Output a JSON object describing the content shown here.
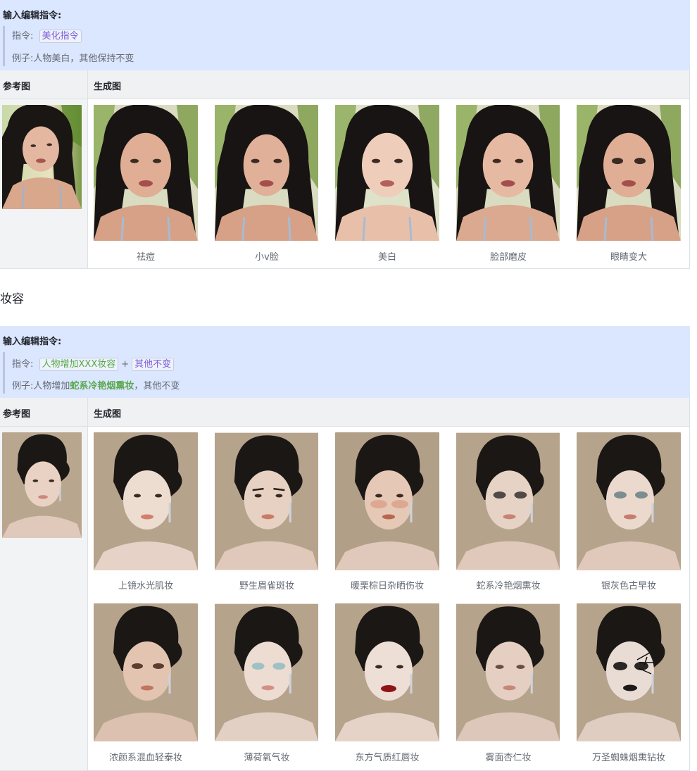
{
  "beauty": {
    "instruction_title": "输入编辑指令:",
    "cmd_label": "指令:",
    "cmd_tag": "美化指令",
    "example_prefix": "例子:",
    "example_text": "人物美白，其他保持不变",
    "ref_header": "参考图",
    "gen_header": "生成图",
    "captions": [
      "祛痘",
      "小v脸",
      "美白",
      "脸部磨皮",
      "眼睛变大"
    ]
  },
  "makeup_section_title": "妆容",
  "makeup": {
    "instruction_title": "输入编辑指令:",
    "cmd_label": "指令:",
    "cmd_tag_1": "人物增加XXX妆容",
    "cmd_plus": "+",
    "cmd_tag_2": "其他不变",
    "example_prefix": "例子:",
    "example_before": "人物增加",
    "example_highlight": "蛇系冷艳烟熏妆",
    "example_after": "，其他不变",
    "ref_header": "参考图",
    "gen_header": "生成图",
    "captions_row1": [
      "上镜水光肌妆",
      "野生眉雀斑妆",
      "暖栗棕日杂晒伤妆",
      "蛇系冷艳烟熏妆",
      "银灰色古早妆"
    ],
    "captions_row2": [
      "浓颜系混血轻泰妆",
      "薄荷氧气妆",
      "东方气质红唇妆",
      "雾面杏仁妆",
      "万圣蜘蛛烟熏钻妆"
    ]
  },
  "colors": {
    "instruction_bg": "#dbe6ff",
    "tag_purple": "#7a5bd6",
    "tag_green": "#59a84a",
    "table_header_bg": "#f0f1f3"
  }
}
